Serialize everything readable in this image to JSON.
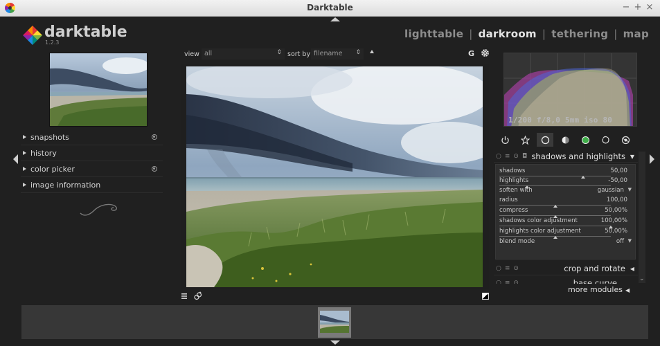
{
  "window": {
    "title": "Darktable",
    "controls": [
      "−",
      "+",
      "×"
    ]
  },
  "logo": {
    "name": "darktable",
    "version": "1.2.3"
  },
  "views": {
    "items": [
      "lighttable",
      "darkroom",
      "tethering",
      "map"
    ],
    "active": "darkroom",
    "separator": "|"
  },
  "left_panel": {
    "modules": [
      {
        "label": "snapshots",
        "has_reset": true
      },
      {
        "label": "history",
        "has_reset": false
      },
      {
        "label": "color picker",
        "has_reset": true
      },
      {
        "label": "image information",
        "has_reset": false
      }
    ]
  },
  "toolbar": {
    "view_label": "view",
    "view_value": "all",
    "sort_label": "sort by",
    "sort_value": "filename",
    "grouping_label": "G"
  },
  "histogram": {
    "exif": "1/200 f/8,0 5mm iso 80"
  },
  "module_groups": [
    "power-icon",
    "star-icon",
    "circle-icon",
    "half-circle-icon",
    "color-icon",
    "rotate-icon",
    "effects-icon"
  ],
  "shadows_highlights": {
    "title": "shadows and highlights",
    "sliders": [
      {
        "label": "shadows",
        "value": "50,00",
        "fraction": 0.75
      },
      {
        "label": "highlights",
        "value": "-50,00",
        "fraction": 0.25
      },
      {
        "label": "soften with",
        "value": "gaussian",
        "dropdown": true
      },
      {
        "label": "radius",
        "value": "100,00",
        "fraction": 0.5
      },
      {
        "label": "compress",
        "value": "50,00%",
        "fraction": 0.5
      },
      {
        "label": "shadows color adjustment",
        "value": "100,00%",
        "fraction": 1.0
      },
      {
        "label": "highlights color adjustment",
        "value": "50,00%",
        "fraction": 0.5
      },
      {
        "label": "blend mode",
        "value": "off",
        "dropdown": true
      }
    ]
  },
  "modules": {
    "crop": "crop and rotate",
    "basecurve": "base curve",
    "more": "more modules"
  },
  "colors": {
    "background": "#202020",
    "panel": "#2f2f2f",
    "text": "#d2d2d2",
    "filmstrip": "#373737"
  }
}
